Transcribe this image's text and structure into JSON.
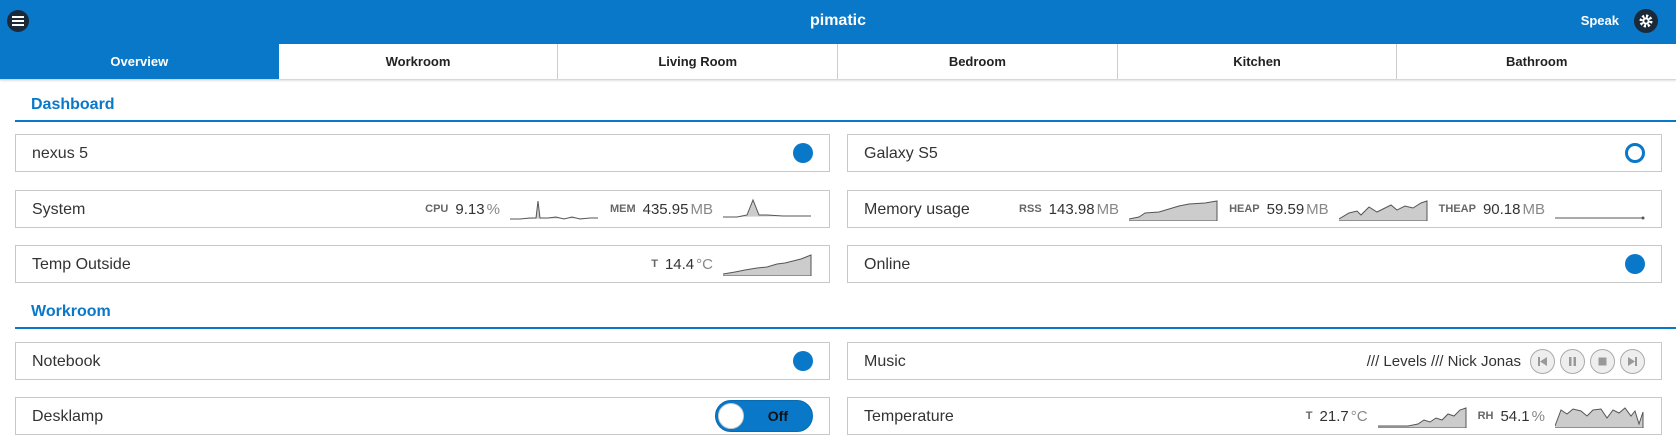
{
  "header": {
    "title": "pimatic",
    "speak_label": "Speak",
    "menu_icon": "menu-icon",
    "settings_icon": "gear-icon"
  },
  "tabs": [
    "Overview",
    "Workroom",
    "Living Room",
    "Bedroom",
    "Kitchen",
    "Bathroom"
  ],
  "sections": {
    "dashboard": "Dashboard",
    "workroom": "Workroom"
  },
  "devices": {
    "nexus": {
      "name": "nexus 5",
      "state": "present"
    },
    "galaxy": {
      "name": "Galaxy S5",
      "state": "absent"
    },
    "system": {
      "name": "System",
      "cpu_label": "CPU",
      "cpu_value": "9.13",
      "cpu_unit": "%",
      "mem_label": "MEM",
      "mem_value": "435.95",
      "mem_unit": "MB"
    },
    "memory": {
      "name": "Memory usage",
      "rss_label": "RSS",
      "rss_value": "143.98",
      "rss_unit": "MB",
      "heap_label": "HEAP",
      "heap_value": "59.59",
      "heap_unit": "MB",
      "theap_label": "THEAP",
      "theap_value": "90.18",
      "theap_unit": "MB"
    },
    "temp_outside": {
      "name": "Temp Outside",
      "t_label": "T",
      "t_value": "14.4",
      "t_unit": "°C"
    },
    "online": {
      "name": "Online",
      "state": "present"
    },
    "notebook": {
      "name": "Notebook",
      "state": "present"
    },
    "music": {
      "name": "Music",
      "now_playing": "/// Levels /// Nick Jonas"
    },
    "desklamp": {
      "name": "Desklamp",
      "switch_label": "Off"
    },
    "temperature": {
      "name": "Temperature",
      "t_label": "T",
      "t_value": "21.7",
      "t_unit": "°C",
      "rh_label": "RH",
      "rh_value": "54.1",
      "rh_unit": "%"
    }
  },
  "colors": {
    "accent": "#0a78c8",
    "header_icon_bg": "#1a2a3a",
    "sparkline_fill": "#cccccc"
  }
}
